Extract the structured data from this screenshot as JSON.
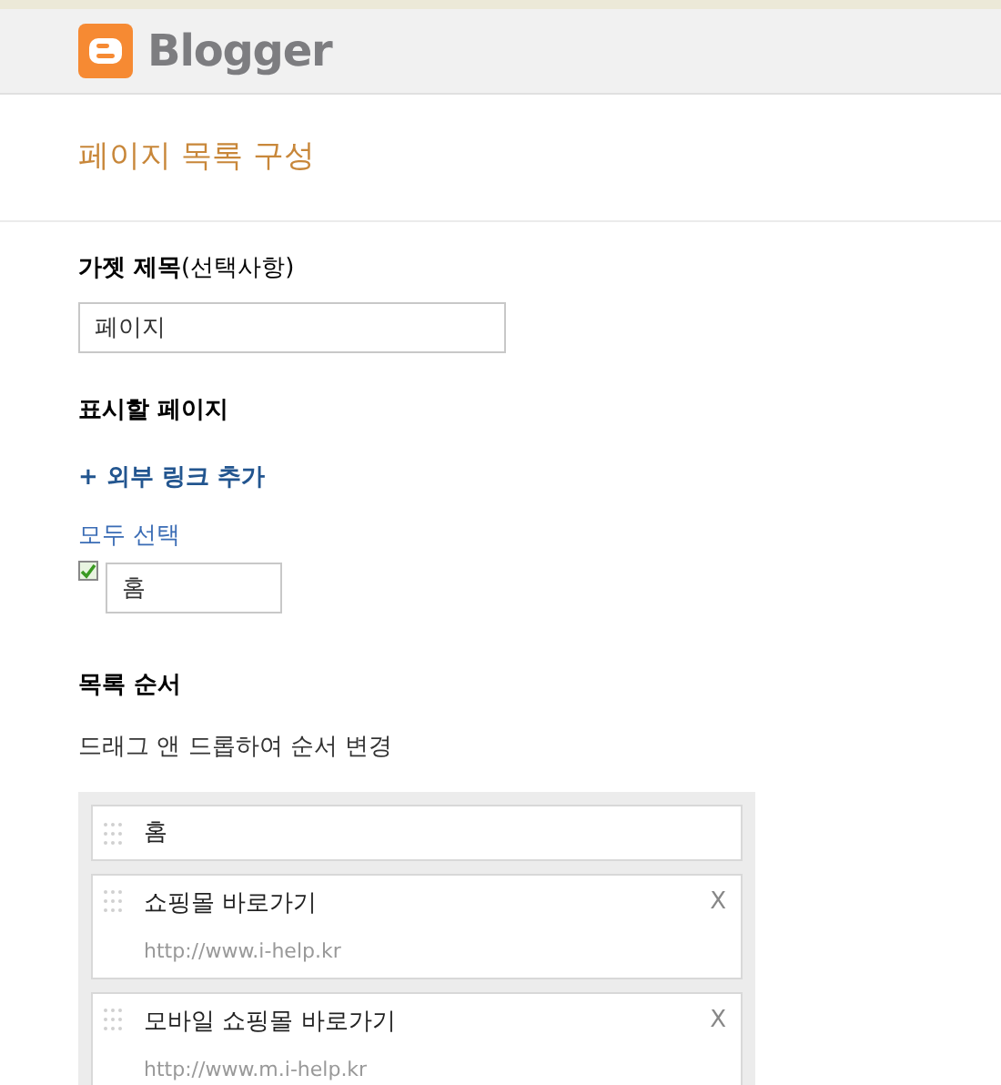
{
  "header": {
    "logo_text": "Blogger"
  },
  "dialog_title": "페이지 목록 구성",
  "gadget_title": {
    "label": "가젯 제목",
    "hint": "(선택사항)",
    "value": "페이지"
  },
  "pages_to_show": {
    "heading": "표시할 페이지",
    "add_link": "+ 외부 링크 추가",
    "select_all": "모두 선택",
    "pages": [
      {
        "title": "홈",
        "checked": true
      }
    ]
  },
  "list_order": {
    "heading": "목록 순서",
    "instruction": "드래그 앤 드롭하여 순서 변경",
    "items": [
      {
        "kind": "page",
        "title": "홈"
      },
      {
        "kind": "link",
        "title": "쇼핑몰 바로가기",
        "url": "http://www.i-help.kr",
        "remove": "X"
      },
      {
        "kind": "link",
        "title": "모바일 쇼핑몰 바로가기",
        "url": "http://www.m.i-help.kr",
        "remove": "X"
      }
    ]
  }
}
